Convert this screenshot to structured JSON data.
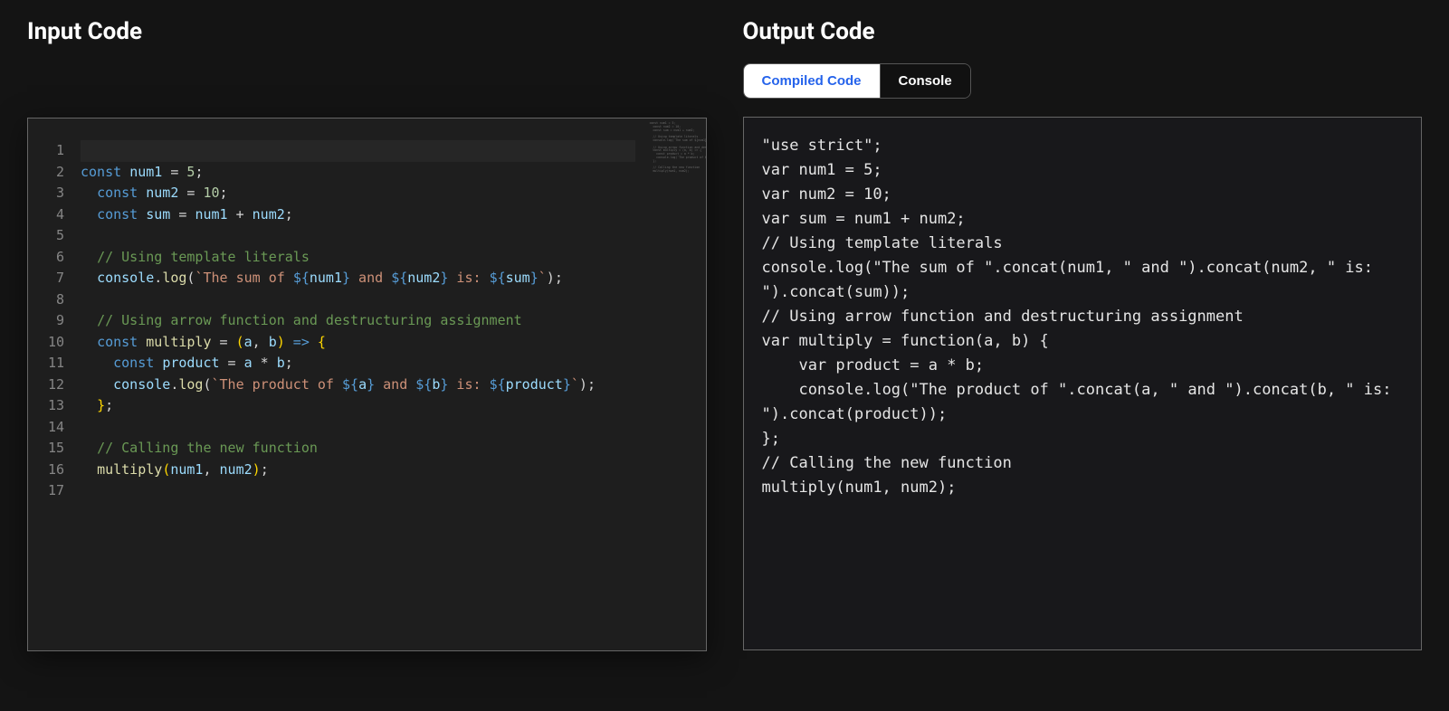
{
  "input": {
    "title": "Input Code",
    "line_numbers": [
      "1",
      "2",
      "3",
      "4",
      "5",
      "6",
      "7",
      "8",
      "9",
      "10",
      "11",
      "12",
      "13",
      "14",
      "15",
      "16",
      "17"
    ],
    "lines": {
      "l1": "",
      "l2": {
        "const": "const",
        "name": "num1",
        "eq": " = ",
        "val": "5",
        "semi": ";"
      },
      "l3": {
        "const": "const",
        "name": "num2",
        "eq": " = ",
        "val": "10",
        "semi": ";"
      },
      "l4": {
        "const": "const",
        "name": "sum",
        "eq": " = ",
        "v1": "num1",
        "plus": " + ",
        "v2": "num2",
        "semi": ";"
      },
      "l5": "",
      "l6": {
        "comment": "// Using template literals"
      },
      "l7": {
        "obj": "console",
        "dot": ".",
        "method": "log",
        "open": "(",
        "tick": "`",
        "t1": "The sum of ",
        "d1o": "${",
        "d1v": "num1",
        "d1c": "}",
        "t2": " and ",
        "d2o": "${",
        "d2v": "num2",
        "d2c": "}",
        "t3": " is: ",
        "d3o": "${",
        "d3v": "sum",
        "d3c": "}",
        "tick2": "`",
        "close": ")",
        "semi": ";"
      },
      "l8": "",
      "l9": {
        "comment": "// Using arrow function and destructuring assignment"
      },
      "l10": {
        "const": "const",
        "name": "multiply",
        "eq": " = ",
        "po": "(",
        "a": "a",
        "comma": ", ",
        "b": "b",
        "pc": ")",
        "arrow": " => ",
        "brace": "{"
      },
      "l11": {
        "const": "const",
        "name": "product",
        "eq": " = ",
        "a": "a",
        "mul": " * ",
        "b": "b",
        "semi": ";"
      },
      "l12": {
        "obj": "console",
        "dot": ".",
        "method": "log",
        "open": "(",
        "tick": "`",
        "t1": "The product of ",
        "d1o": "${",
        "d1v": "a",
        "d1c": "}",
        "t2": " and ",
        "d2o": "${",
        "d2v": "b",
        "d2c": "}",
        "t3": " is: ",
        "d3o": "${",
        "d3v": "product",
        "d3c": "}",
        "tick2": "`",
        "close": ")",
        "tail": ";"
      },
      "l13": {
        "brace": "}",
        "semi": ";"
      },
      "l14": "",
      "l15": {
        "comment": "// Calling the new function"
      },
      "l16": {
        "fn": "multiply",
        "po": "(",
        "a": "num1",
        "comma": ", ",
        "b": "num2",
        "pc": ")",
        "semi": ";"
      },
      "l17": ""
    },
    "minimap_text": "const num1 = 5;\n  const num2 = 10;\n  const sum = num1 + num2;\n\n  // Using template literals\n  console.log(`The sum of ${num1} and ${num2} is: ${sum}`);\n\n  // Using arrow function and destructuring assignment\n  const multiply = (a, b) => {\n    const product = a * b;\n    console.log(`The product of ${a} and ${b} is: ${product}`);\n  };\n\n  // Calling the new function\n  multiply(num1, num2);"
  },
  "output": {
    "title": "Output Code",
    "tabs": {
      "compiled": "Compiled Code",
      "console": "Console"
    },
    "code": "\"use strict\";\nvar num1 = 5;\nvar num2 = 10;\nvar sum = num1 + num2;\n// Using template literals\nconsole.log(\"The sum of \".concat(num1, \" and \").concat(num2, \" is: \").concat(sum));\n// Using arrow function and destructuring assignment\nvar multiply = function(a, b) {\n    var product = a * b;\n    console.log(\"The product of \".concat(a, \" and \").concat(b, \" is: \").concat(product));\n};\n// Calling the new function\nmultiply(num1, num2);"
  }
}
